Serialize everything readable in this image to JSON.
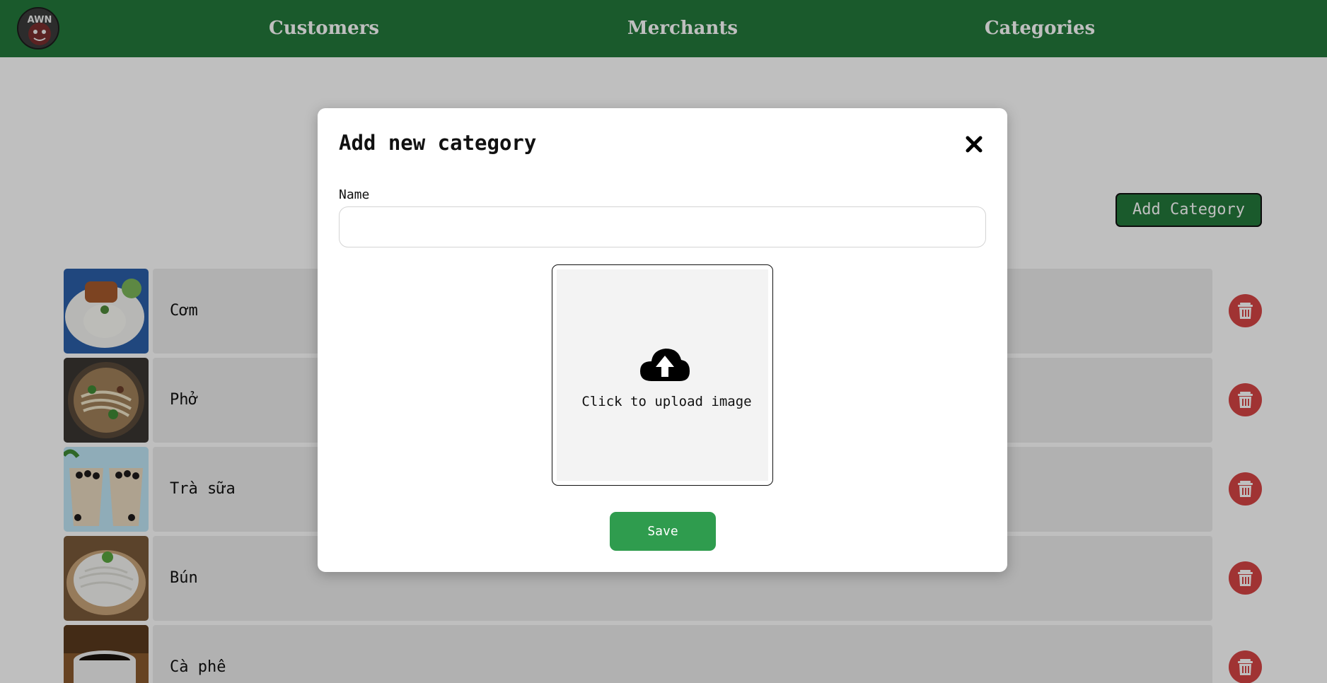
{
  "navbar": {
    "logo_text": "AWN",
    "links": [
      "Customers",
      "Merchants",
      "Categories"
    ]
  },
  "page": {
    "add_category_label": "Add Category"
  },
  "categories": [
    {
      "name": "Cơm",
      "image": "rice-plate-image"
    },
    {
      "name": "Phở",
      "image": "pho-bowl-image"
    },
    {
      "name": "Trà sữa",
      "image": "milk-tea-image"
    },
    {
      "name": "Bún",
      "image": "rice-noodles-image"
    },
    {
      "name": "Cà phê",
      "image": "coffee-cup-image"
    }
  ],
  "modal": {
    "title": "Add new category",
    "name_label": "Name",
    "name_value": "",
    "upload_text": "Click to upload image",
    "save_label": "Save"
  },
  "colors": {
    "brand_green": "#23783b",
    "save_green": "#2f9c4e",
    "delete_red": "#d64545"
  }
}
